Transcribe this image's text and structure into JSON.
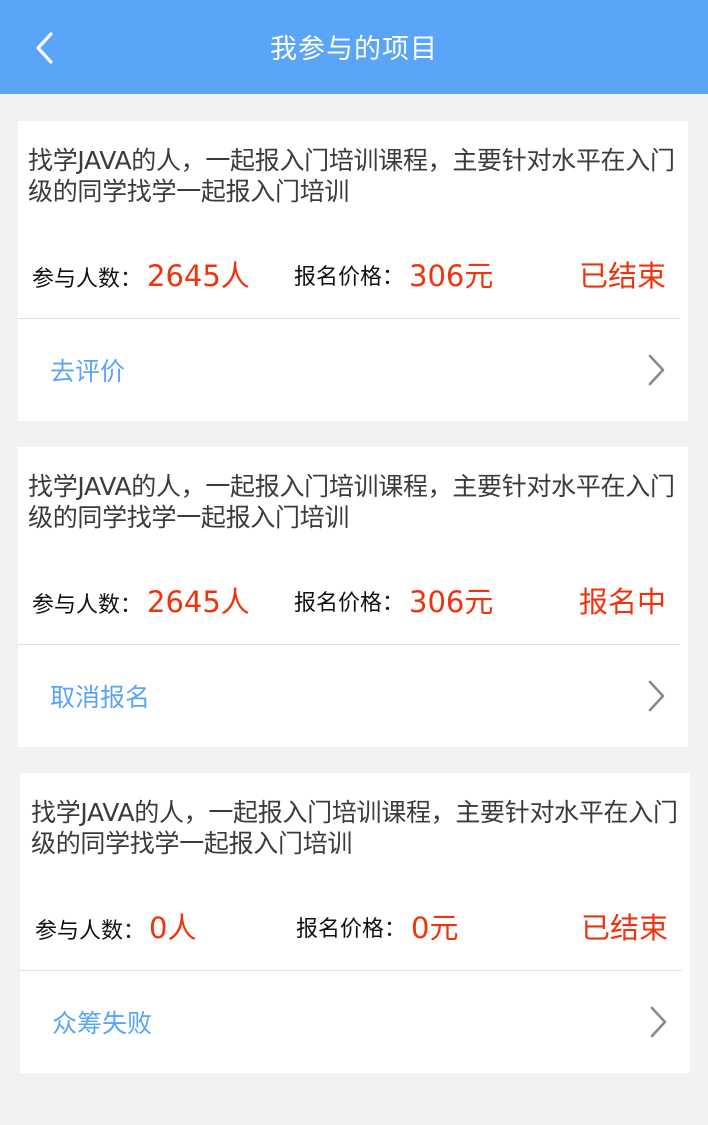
{
  "header": {
    "title": "我参与的项目"
  },
  "projects": [
    {
      "description": "找学JAVA的人，一起报入门培训课程，主要针对水平在入门级的同学找学一起报入门培训",
      "participants_label": "参与人数：",
      "participants_value": "2645人",
      "price_label": "报名价格：",
      "price_value": "306元",
      "status": "已结束",
      "action": "去评价"
    },
    {
      "description": "找学JAVA的人，一起报入门培训课程，主要针对水平在入门级的同学找学一起报入门培训",
      "participants_label": "参与人数：",
      "participants_value": "2645人",
      "price_label": "报名价格：",
      "price_value": "306元",
      "status": "报名中",
      "action": "取消报名"
    },
    {
      "description": "找学JAVA的人，一起报入门培训课程，主要针对水平在入门级的同学找学一起报入门培训",
      "participants_label": "参与人数：",
      "participants_value": "0人",
      "price_label": "报名价格：",
      "price_value": "0元",
      "status": "已结束",
      "action": "众筹失败"
    }
  ],
  "colors": {
    "header_bg": "#5aa5f7",
    "accent_red": "#f0330c",
    "link_blue": "#5aa5f7",
    "page_bg": "#f2f2f2"
  },
  "icons": {
    "back": "chevron-left-icon",
    "row_arrow": "chevron-right-icon"
  }
}
